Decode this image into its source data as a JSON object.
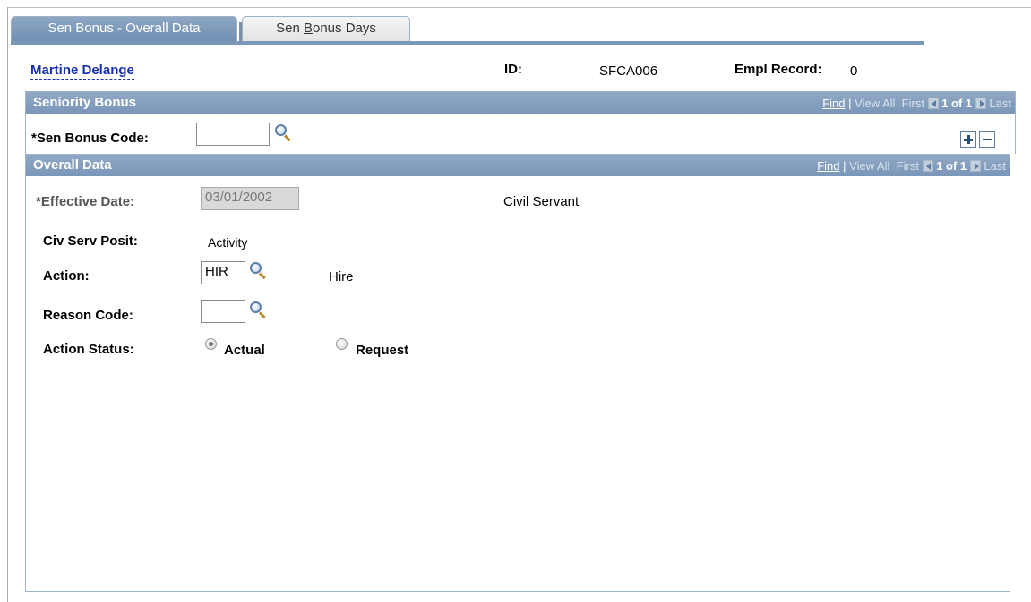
{
  "tabs": [
    {
      "label": "Sen Bonus - Overall Data"
    },
    {
      "label_pre": "Sen ",
      "label_key": "B",
      "label_post": "onus Days"
    }
  ],
  "header": {
    "employee_name": "Martine Delange",
    "id_label": "ID:",
    "id_value": "SFCA006",
    "empl_record_label": "Empl Record:",
    "empl_record_value": "0"
  },
  "seniority_bonus": {
    "title": "Seniority Bonus",
    "nav": {
      "find": "Find",
      "sep": "|",
      "view_all": "View All",
      "first": "First",
      "count": "1 of 1",
      "last": "Last"
    },
    "sen_bonus_code_label": "*Sen Bonus Code:",
    "sen_bonus_code_value": ""
  },
  "overall_data": {
    "title": "Overall Data",
    "nav": {
      "find": "Find",
      "sep": "|",
      "view_all": "View All",
      "first": "First",
      "count": "1 of 1",
      "last": "Last"
    },
    "effective_date_label": "*Effective Date:",
    "effective_date_value": "03/01/2002",
    "civil_servant_text": "Civil Servant",
    "civ_serv_posit_label": "Civ Serv Posit:",
    "civ_serv_posit_value": "Activity",
    "action_label": "Action:",
    "action_value": "HIR",
    "action_desc": "Hire",
    "reason_code_label": "Reason Code:",
    "reason_code_value": "",
    "action_status_label": "Action Status:",
    "action_status_options": [
      {
        "label": "Actual",
        "checked": true
      },
      {
        "label": "Request",
        "checked": false
      }
    ]
  },
  "icons": {
    "lookup": "magnifier-icon",
    "add_row": "plus-icon",
    "delete_row": "minus-icon",
    "prev": "arrow-left-icon",
    "next": "arrow-right-icon"
  },
  "colors": {
    "header_blue": "#7a96b8",
    "link_blue": "#1a2fb0",
    "border": "#a3b4c8"
  }
}
